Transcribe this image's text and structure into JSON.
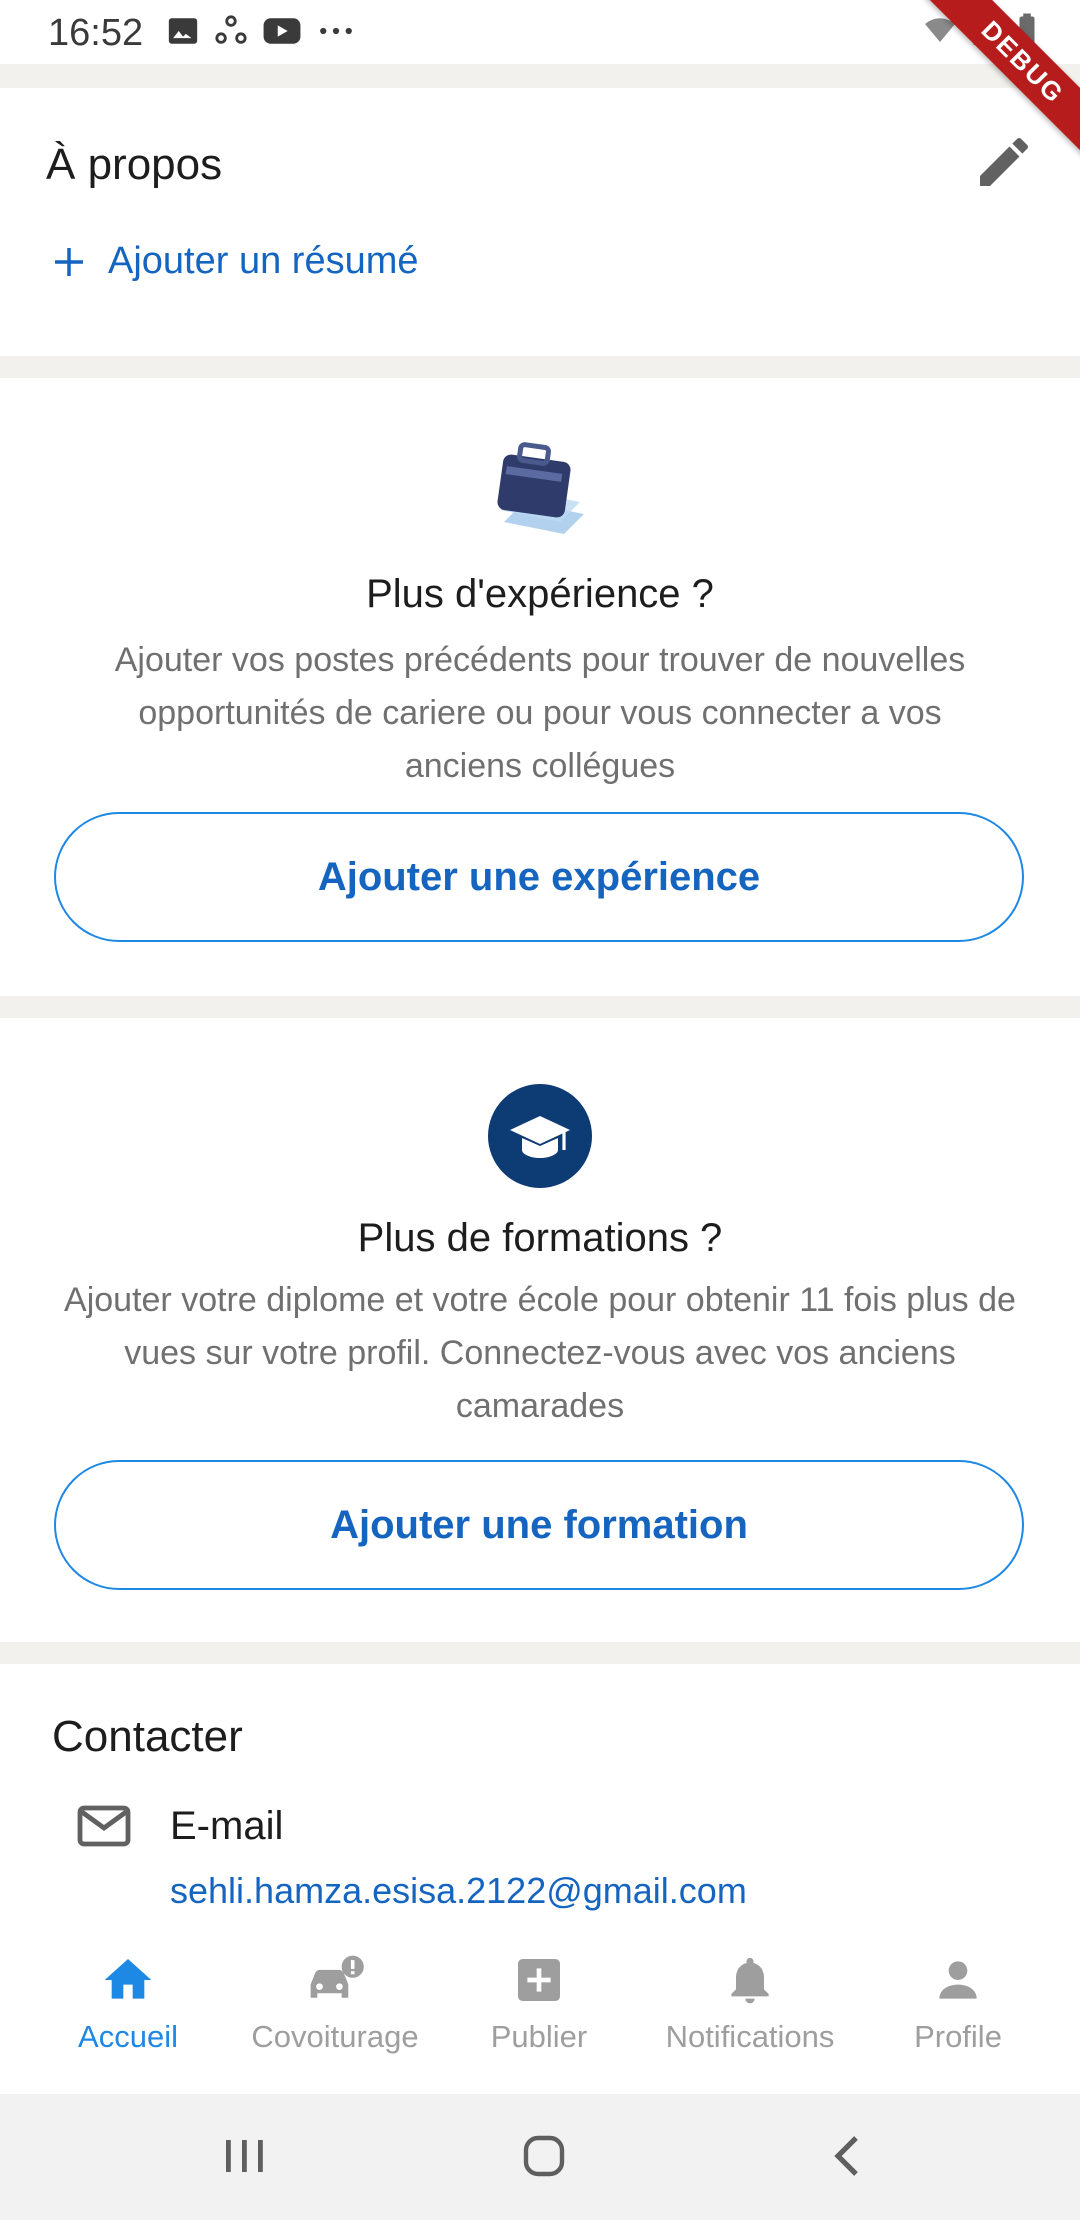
{
  "status_bar": {
    "time": "16:52",
    "left_icons": [
      "image-icon",
      "sync-icon",
      "youtube-icon",
      "more-dots-icon"
    ],
    "right_icons": [
      "wifi-icon",
      "signal-icon",
      "battery-icon"
    ]
  },
  "debug_banner": "DEBUG",
  "about": {
    "title": "À propos",
    "edit_icon": "pencil-icon",
    "add_summary_label": "Ajouter un résumé"
  },
  "experience": {
    "illustration": "briefcase-icon",
    "title": "Plus d'expérience ?",
    "description": "Ajouter vos postes précédents pour trouver de nouvelles opportunités de cariere ou pour vous connecter a vos anciens collégues",
    "button_label": "Ajouter une expérience"
  },
  "education": {
    "illustration": "graduation-cap-icon",
    "title": "Plus de formations ?",
    "description": "Ajouter votre diplome et votre école pour obtenir 11 fois plus de vues sur votre profil. Connectez-vous avec vos anciens camarades",
    "button_label": "Ajouter une formation"
  },
  "contact": {
    "title": "Contacter",
    "email_label": "E-mail",
    "email_value": "sehli.hamza.esisa.2122@gmail.com"
  },
  "bottom_nav": {
    "items": [
      {
        "label": "Accueil",
        "icon": "home-icon",
        "active": true
      },
      {
        "label": "Covoiturage",
        "icon": "car-alert-icon",
        "active": false
      },
      {
        "label": "Publier",
        "icon": "add-box-icon",
        "active": false
      },
      {
        "label": "Notifications",
        "icon": "bell-icon",
        "active": false
      },
      {
        "label": "Profile",
        "icon": "person-icon",
        "active": false
      }
    ]
  },
  "colors": {
    "accent": "#1e88e5",
    "link": "#1565c0",
    "inactive": "#9e9e9e",
    "cap_circle": "#0d3b73",
    "debug": "#b71c1c"
  }
}
